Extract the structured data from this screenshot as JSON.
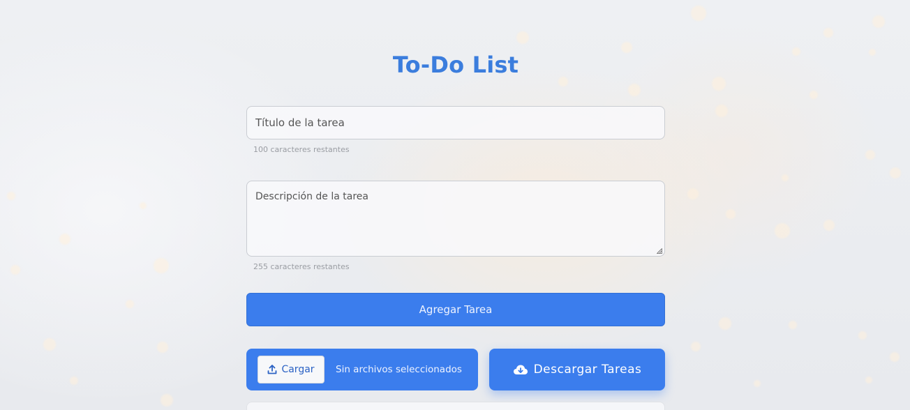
{
  "app": {
    "title": "To-Do List"
  },
  "form": {
    "title_placeholder": "Título de la tarea",
    "title_hint": "100 caracteres restantes",
    "description_placeholder": "Descripción de la tarea",
    "description_hint": "255 caracteres restantes",
    "add_button_label": "Agregar Tarea"
  },
  "file_actions": {
    "upload_label": "Cargar",
    "upload_status": "Sin archivos seleccionados",
    "download_label": "Descargar Tareas"
  },
  "colors": {
    "accent": "#3b7ded",
    "title": "#3b7ddd"
  },
  "icons": {
    "upload": "upload-icon",
    "download": "cloud-download-icon"
  }
}
